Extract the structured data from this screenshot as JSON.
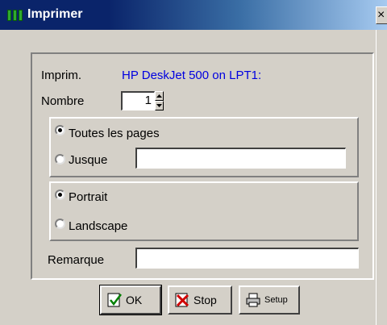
{
  "window": {
    "title": "Imprimer",
    "close_label": "×",
    "app_icon": "printer-app-icon"
  },
  "printer": {
    "label": "Imprim.",
    "name": "HP DeskJet 500 on LPT1:"
  },
  "copies": {
    "label": "Nombre",
    "value": "1"
  },
  "page_range": {
    "all_label": "Toutes les pages",
    "until_label": "Jusque",
    "until_value": "",
    "selected": "all"
  },
  "orientation": {
    "portrait_label": "Portrait",
    "landscape_label": "Landscape",
    "selected": "portrait"
  },
  "remark": {
    "label": "Remarque",
    "value": ""
  },
  "buttons": {
    "ok_label": "OK",
    "ok_icon": "check-icon",
    "stop_label": "Stop",
    "stop_icon": "cross-icon",
    "setup_label": "Setup",
    "setup_icon": "printer-icon"
  },
  "colors": {
    "titlebar": "#0a246a",
    "printer_name": "#0000e0",
    "face": "#d4d0c8"
  }
}
